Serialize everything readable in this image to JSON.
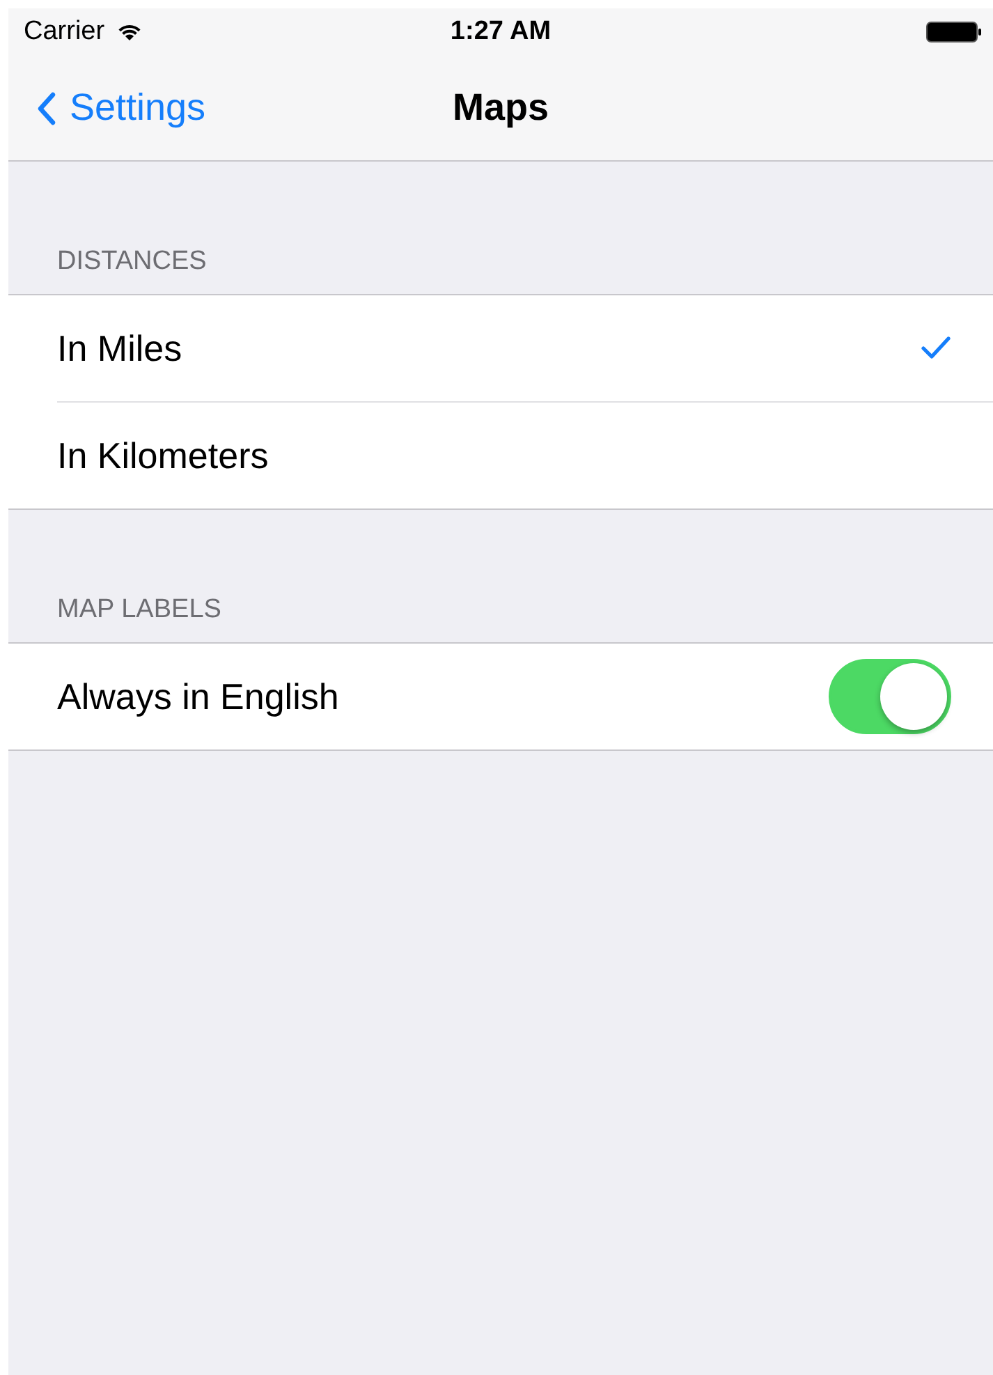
{
  "status_bar": {
    "carrier": "Carrier",
    "time": "1:27 AM"
  },
  "nav_bar": {
    "back_label": "Settings",
    "title": "Maps"
  },
  "sections": [
    {
      "header": "DISTANCES",
      "rows": [
        {
          "kind": "choice",
          "label": "In Miles",
          "selected": true
        },
        {
          "kind": "choice",
          "label": "In Kilometers",
          "selected": false
        }
      ]
    },
    {
      "header": "MAP LABELS",
      "rows": [
        {
          "kind": "toggle",
          "label": "Always in English",
          "on": true
        }
      ]
    }
  ]
}
